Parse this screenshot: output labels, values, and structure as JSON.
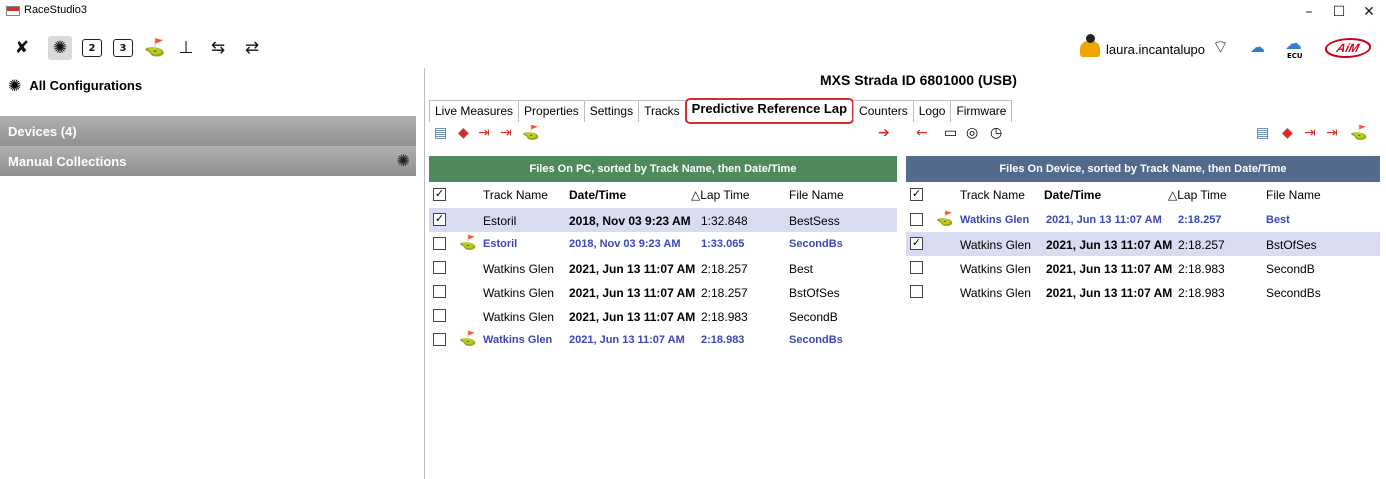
{
  "app": {
    "title": "RaceStudio3",
    "window_controls": {
      "minimize": "–",
      "maximize": "☐",
      "close": "✕"
    }
  },
  "toolbar": {
    "icons": [
      "wrench-icon",
      "configuration-icon",
      "v2-icon",
      "v3-icon",
      "track-icon",
      "thermometer-icon",
      "connect-icon",
      "transfer-icon"
    ],
    "v2_label": "2",
    "v3_label": "3"
  },
  "user": {
    "name": "laura.incantalupo",
    "ecu_label": "ECU",
    "logo_text": "AiM"
  },
  "sidebar": {
    "title": "All Configurations",
    "groups": [
      {
        "label": "Devices  (4)"
      },
      {
        "label": "Manual Collections"
      }
    ]
  },
  "device": {
    "title": "MXS Strada ID 6801000 (USB)"
  },
  "tabs": [
    {
      "label": "Live Measures",
      "active": false
    },
    {
      "label": "Properties",
      "active": false
    },
    {
      "label": "Settings",
      "active": false
    },
    {
      "label": "Tracks",
      "active": false
    },
    {
      "label": "Predictive Reference Lap",
      "active": true
    },
    {
      "label": "Counters",
      "active": false
    },
    {
      "label": "Logo",
      "active": false
    },
    {
      "label": "Firmware",
      "active": false
    }
  ],
  "colors": {
    "pc_header": "#4e8a5e",
    "device_header": "#536a8c",
    "highlight_border": "#d32f2f",
    "blue_text": "#3a47b8"
  },
  "pc_panel": {
    "title": "Files On PC, sorted by Track Name, then Date/Time",
    "columns": [
      "Track Name",
      "Date/Time",
      "△Lap Time",
      "File Name"
    ],
    "rows": [
      {
        "checked": true,
        "track": "Estoril",
        "date": "2018, Nov 03 9:23 AM",
        "lap": "1:32.848",
        "file": "BestSess",
        "selected": true,
        "blue": false,
        "flag": false
      },
      {
        "checked": false,
        "track": "Estoril",
        "date": "2018, Nov 03 9:23 AM",
        "lap": "1:33.065",
        "file": "SecondBs",
        "selected": false,
        "blue": true,
        "flag": true
      },
      {
        "checked": false,
        "track": "Watkins Glen",
        "date": "2021, Jun 13 11:07 AM",
        "lap": "2:18.257",
        "file": "Best",
        "selected": false,
        "blue": false,
        "flag": false
      },
      {
        "checked": false,
        "track": "Watkins Glen",
        "date": "2021, Jun 13 11:07 AM",
        "lap": "2:18.257",
        "file": "BstOfSes",
        "selected": false,
        "blue": false,
        "flag": false
      },
      {
        "checked": false,
        "track": "Watkins Glen",
        "date": "2021, Jun 13 11:07 AM",
        "lap": "2:18.983",
        "file": "SecondB",
        "selected": false,
        "blue": false,
        "flag": false
      },
      {
        "checked": false,
        "track": "Watkins Glen",
        "date": "2021, Jun 13 11:07 AM",
        "lap": "2:18.983",
        "file": "SecondBs",
        "selected": false,
        "blue": true,
        "flag": true
      }
    ]
  },
  "device_panel": {
    "title": "Files On Device, sorted by Track Name, then Date/Time",
    "columns": [
      "Track Name",
      "Date/Time",
      "△Lap Time",
      "File Name"
    ],
    "rows": [
      {
        "checked": false,
        "track": "Watkins Glen",
        "date": "2021, Jun 13 11:07 AM",
        "lap": "2:18.257",
        "file": "Best",
        "selected": false,
        "blue": true,
        "flag": true
      },
      {
        "checked": true,
        "track": "Watkins Glen",
        "date": "2021, Jun 13 11:07 AM",
        "lap": "2:18.257",
        "file": "BstOfSes",
        "selected": true,
        "blue": false,
        "flag": false
      },
      {
        "checked": false,
        "track": "Watkins Glen",
        "date": "2021, Jun 13 11:07 AM",
        "lap": "2:18.983",
        "file": "SecondB",
        "selected": false,
        "blue": false,
        "flag": false
      },
      {
        "checked": false,
        "track": "Watkins Glen",
        "date": "2021, Jun 13 11:07 AM",
        "lap": "2:18.983",
        "file": "SecondBs",
        "selected": false,
        "blue": false,
        "flag": false
      }
    ]
  }
}
